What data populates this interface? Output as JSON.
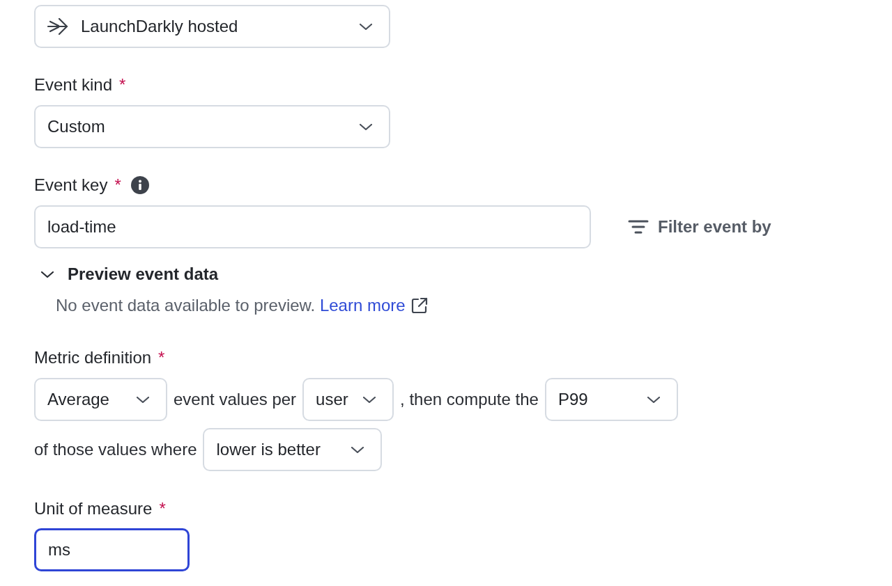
{
  "source_select": {
    "value": "LaunchDarkly hosted"
  },
  "event_kind": {
    "label": "Event kind",
    "required_mark": "*",
    "select": {
      "value": "Custom"
    }
  },
  "event_key": {
    "label": "Event key",
    "required_mark": "*",
    "input": {
      "value": "load-time",
      "focused": false
    },
    "filter_button": {
      "label": "Filter event by"
    }
  },
  "preview_event_data": {
    "title": "Preview event data",
    "expanded": true,
    "message": "No event data available to preview.",
    "link": "Learn more"
  },
  "metric_definition": {
    "label": "Metric definition",
    "required_mark": "*",
    "rows": [
      [
        {
          "kind": "select",
          "value": "Average"
        },
        {
          "kind": "text",
          "text": "event values per"
        },
        {
          "kind": "select",
          "value": "user"
        },
        {
          "kind": "text",
          "text": ", then compute the"
        },
        {
          "kind": "select",
          "value": "P99"
        }
      ],
      [
        {
          "kind": "text",
          "text": "of those values where"
        },
        {
          "kind": "select",
          "value": "lower is better"
        }
      ]
    ]
  },
  "unit_of_measure": {
    "label": "Unit of measure",
    "required_mark": "*",
    "input": {
      "value": "ms",
      "focused": true
    }
  }
}
